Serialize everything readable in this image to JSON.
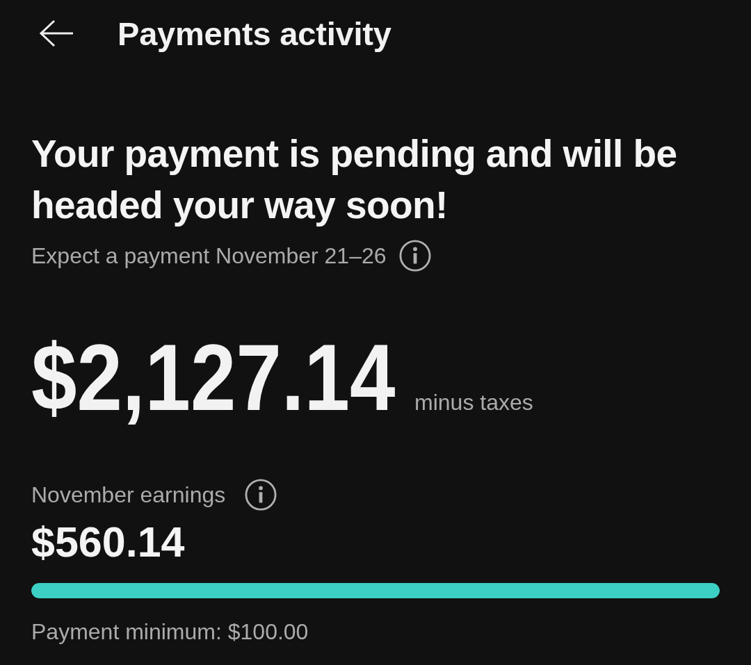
{
  "header": {
    "title": "Payments activity"
  },
  "status": {
    "headline": "Your payment is pending and will be headed your way soon!",
    "expected": "Expect a payment November 21–26"
  },
  "payout": {
    "amount": "$2,127.14",
    "note": "minus taxes"
  },
  "earnings": {
    "label": "November earnings",
    "amount": "$560.14",
    "level": 1,
    "minimum": "Payment minimum: $100.00"
  }
}
